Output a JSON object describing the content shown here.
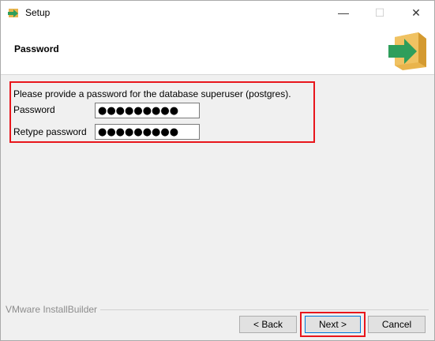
{
  "window": {
    "title": "Setup",
    "minimize_glyph": "—",
    "maximize_glyph": "☐",
    "close_glyph": "✕"
  },
  "header": {
    "title": "Password",
    "logo_icon": "installer-box-arrow-icon"
  },
  "form": {
    "description": "Please provide a password for the database superuser (postgres).",
    "password_label": "Password",
    "password_value": "●●●●●●●●●",
    "retype_label": "Retype password",
    "retype_value": "●●●●●●●●●"
  },
  "footer": {
    "brand": "VMware InstallBuilder",
    "back_label": "< Back",
    "next_label": "Next >",
    "cancel_label": "Cancel"
  },
  "colors": {
    "highlight": "#e8161c",
    "arrow_green": "#2e9e5b",
    "box_tan": "#e9b44c"
  }
}
